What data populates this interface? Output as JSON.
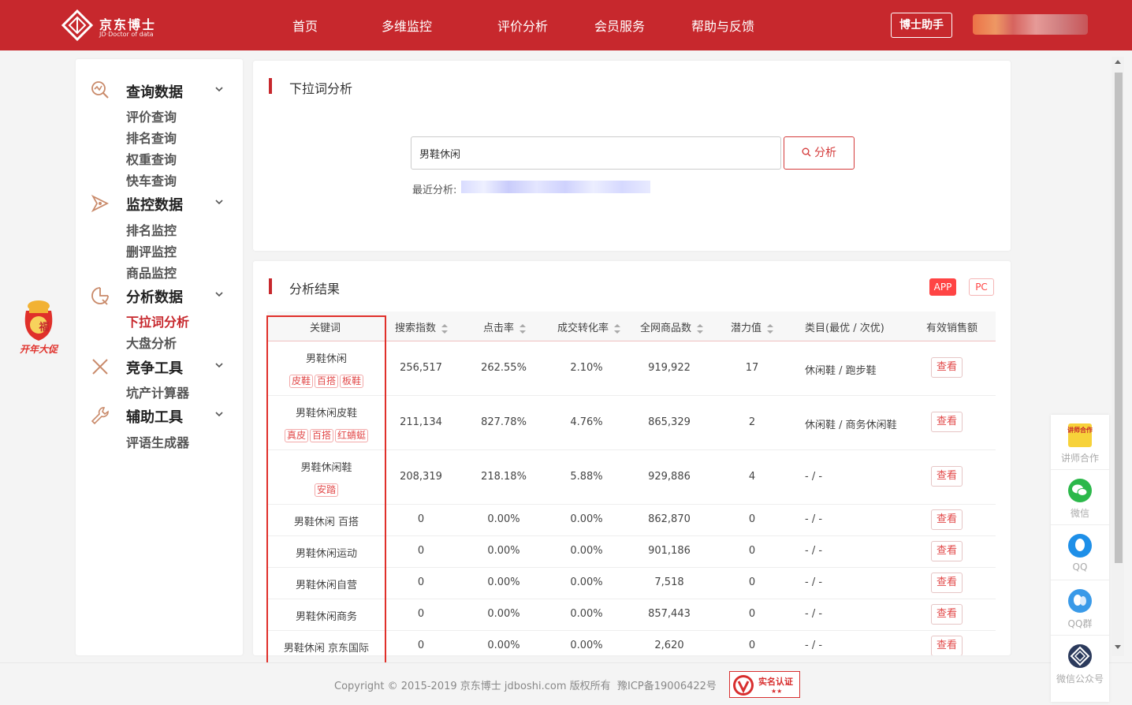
{
  "header": {
    "brand_title": "京东博士",
    "brand_sub": "JD·Doctor of data",
    "nav": [
      "首页",
      "多维监控",
      "评价分析",
      "会员服务",
      "帮助与反馈"
    ],
    "assistant_label": "博士助手"
  },
  "sidebar": {
    "groups": [
      {
        "title": "查询数据",
        "icon": "search-chart-icon",
        "items": [
          "评价查询",
          "排名查询",
          "权重查询",
          "快车查询"
        ]
      },
      {
        "title": "监控数据",
        "icon": "monitor-icon",
        "items": [
          "排名监控",
          "删评监控",
          "商品监控"
        ]
      },
      {
        "title": "分析数据",
        "icon": "analysis-icon",
        "items": [
          "下拉词分析",
          "大盘分析"
        ],
        "active": "下拉词分析"
      },
      {
        "title": "竞争工具",
        "icon": "swords-icon",
        "items": [
          "坑产计算器"
        ]
      },
      {
        "title": "辅助工具",
        "icon": "wrench-icon",
        "items": [
          "评语生成器"
        ]
      }
    ]
  },
  "promo": {
    "text": "开年大促",
    "badge": "福"
  },
  "search_card": {
    "title": "下拉词分析",
    "input_value": "男鞋休闲",
    "button_label": "分析",
    "recent_label": "最近分析:"
  },
  "results": {
    "title": "分析结果",
    "modes": [
      "APP",
      "PC"
    ],
    "columns": [
      "关键词",
      "搜索指数",
      "点击率",
      "成交转化率",
      "全网商品数",
      "潜力值",
      "类目(最优 / 次优)",
      "有效销售额"
    ],
    "rows": [
      {
        "keyword": "男鞋休闲",
        "tags": [
          "皮鞋",
          "百搭",
          "板鞋"
        ],
        "search": "256,517",
        "ctr": "262.55%",
        "cvr": "2.10%",
        "goods": "919,922",
        "potential": "17",
        "category": "休闲鞋 / 跑步鞋",
        "action": "查看"
      },
      {
        "keyword": "男鞋休闲皮鞋",
        "tags": [
          "真皮",
          "百搭",
          "红蜻蜓"
        ],
        "search": "211,134",
        "ctr": "827.78%",
        "cvr": "4.76%",
        "goods": "865,329",
        "potential": "2",
        "category": "休闲鞋 / 商务休闲鞋",
        "action": "查看"
      },
      {
        "keyword": "男鞋休闲鞋",
        "tags": [
          "安踏"
        ],
        "search": "208,319",
        "ctr": "218.18%",
        "cvr": "5.88%",
        "goods": "929,886",
        "potential": "4",
        "category": "- / -",
        "action": "查看"
      },
      {
        "keyword": "男鞋休闲 百搭",
        "tags": [],
        "search": "0",
        "ctr": "0.00%",
        "cvr": "0.00%",
        "goods": "862,870",
        "potential": "0",
        "category": "- / -",
        "action": "查看"
      },
      {
        "keyword": "男鞋休闲运动",
        "tags": [],
        "search": "0",
        "ctr": "0.00%",
        "cvr": "0.00%",
        "goods": "901,186",
        "potential": "0",
        "category": "- / -",
        "action": "查看"
      },
      {
        "keyword": "男鞋休闲自营",
        "tags": [],
        "search": "0",
        "ctr": "0.00%",
        "cvr": "0.00%",
        "goods": "7,518",
        "potential": "0",
        "category": "- / -",
        "action": "查看"
      },
      {
        "keyword": "男鞋休闲商务",
        "tags": [],
        "search": "0",
        "ctr": "0.00%",
        "cvr": "0.00%",
        "goods": "857,443",
        "potential": "0",
        "category": "- / -",
        "action": "查看"
      },
      {
        "keyword": "男鞋休闲 京东国际",
        "tags": [],
        "search": "0",
        "ctr": "0.00%",
        "cvr": "0.00%",
        "goods": "2,620",
        "potential": "0",
        "category": "- / -",
        "action": "查看"
      }
    ]
  },
  "footer": {
    "copyright": "Copyright © 2015-2019 京东博士 jdboshi.com 版权所有",
    "icp": "豫ICP备19006422号",
    "verify": "实名认证",
    "verify_stars": "★★"
  },
  "float_panel": [
    {
      "label": "讲师合作",
      "icon": "lecturer-icon",
      "badge": "讲师合作"
    },
    {
      "label": "微信",
      "icon": "wechat-icon"
    },
    {
      "label": "QQ",
      "icon": "qq-icon"
    },
    {
      "label": "QQ群",
      "icon": "qq-group-icon"
    },
    {
      "label": "微信公众号",
      "icon": "wechat-official-icon"
    }
  ],
  "colors": {
    "brand": "#c7282d",
    "accent": "#f44444"
  }
}
